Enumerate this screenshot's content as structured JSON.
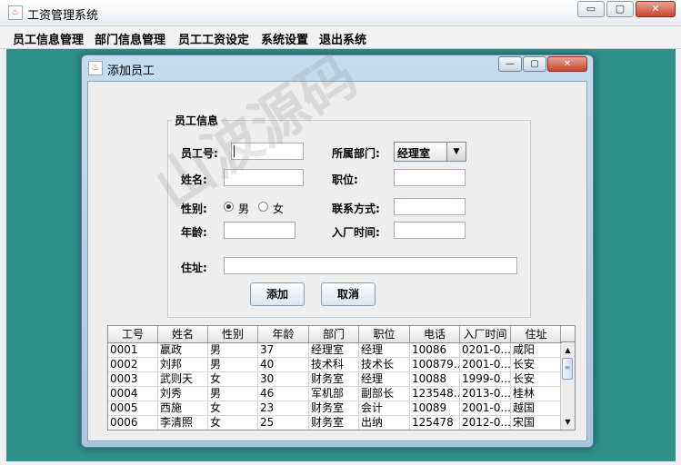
{
  "app": {
    "title": "工资管理系统"
  },
  "window_controls": {
    "minimize": "▭",
    "maximize": "▢",
    "close": "✕"
  },
  "menubar": [
    "员工信息管理",
    "部门信息管理",
    "员工工资设定",
    "系统设置",
    "退出系统"
  ],
  "dialog": {
    "title": "添加员工",
    "controls": {
      "minimize": "—",
      "maximize": "▢",
      "close": "✕"
    },
    "group_title": "员工信息",
    "labels": {
      "emp_id": "员工号:",
      "name": "姓名:",
      "gender": "性别:",
      "age": "年龄:",
      "address": "住址:",
      "department": "所属部门:",
      "position": "职位:",
      "contact": "联系方式:",
      "hire_date": "入厂时间:"
    },
    "gender_options": {
      "male": "男",
      "female": "女",
      "selected": "male"
    },
    "department_selected": "经理室",
    "buttons": {
      "add": "添加",
      "cancel": "取消"
    }
  },
  "table": {
    "columns": [
      "工号",
      "姓名",
      "性别",
      "年龄",
      "部门",
      "职位",
      "电话",
      "入厂时间",
      "住址"
    ],
    "rows": [
      [
        "0001",
        "嬴政",
        "男",
        "37",
        "经理室",
        "经理",
        "10086",
        "0201-0...",
        "咸阳"
      ],
      [
        "0002",
        "刘邦",
        "男",
        "40",
        "技术科",
        "技术长",
        "100879...",
        "2001-0...",
        "长安"
      ],
      [
        "0003",
        "武则天",
        "女",
        "30",
        "财务室",
        "经理",
        "10088",
        "1999-0...",
        "长安"
      ],
      [
        "0004",
        "刘秀",
        "男",
        "46",
        "军机部",
        "副部长",
        "123548...",
        "2013-0...",
        "桂林"
      ],
      [
        "0005",
        "西施",
        "女",
        "23",
        "财务室",
        "会计",
        "10089",
        "2001-0...",
        "越国"
      ],
      [
        "0006",
        "李清照",
        "女",
        "25",
        "财务室",
        "出纳",
        "125478",
        "2012-0...",
        "宋国"
      ]
    ]
  },
  "watermark": "山波源码"
}
